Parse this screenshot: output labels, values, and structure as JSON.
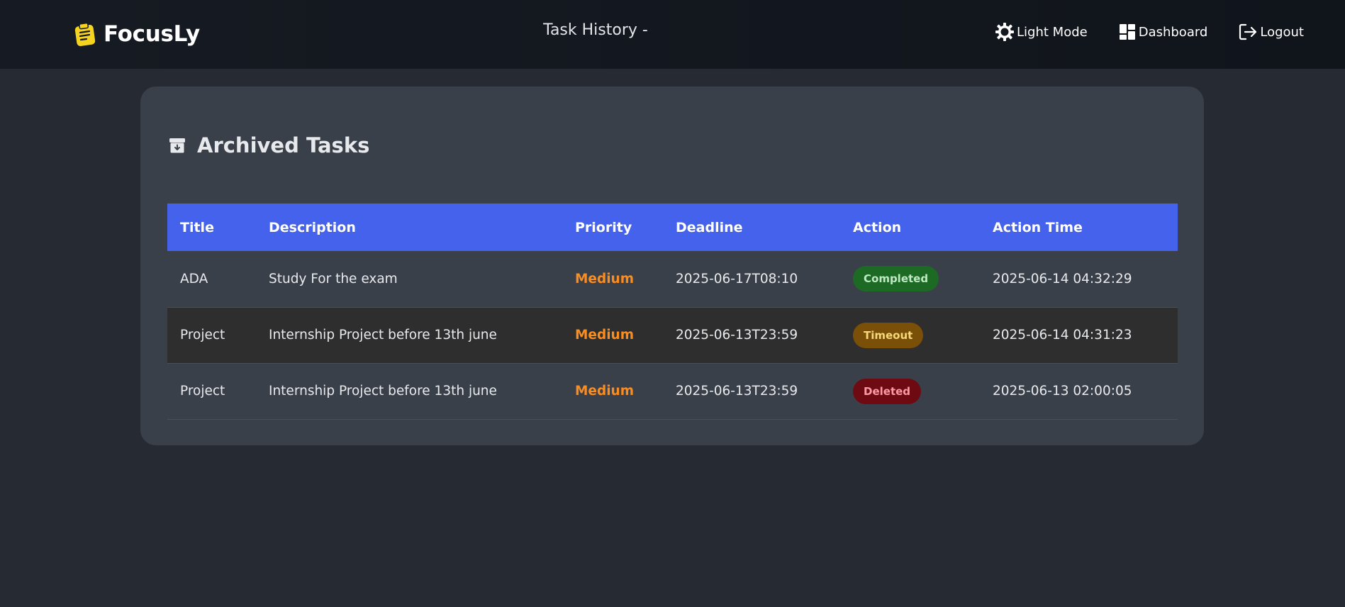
{
  "navbar": {
    "brand": "FocusLy",
    "center_title": "Task History -",
    "links": [
      {
        "label": "Light Mode",
        "icon": "sun-icon"
      },
      {
        "label": "Dashboard",
        "icon": "dashboard-icon"
      },
      {
        "label": "Logout",
        "icon": "logout-icon"
      }
    ]
  },
  "archive": {
    "title": "Archived Tasks",
    "icon": "archive-icon",
    "columns": [
      "Title",
      "Description",
      "Priority",
      "Deadline",
      "Action",
      "Action Time"
    ],
    "rows": [
      {
        "title": "ADA",
        "description": "Study For the exam",
        "priority": "Medium",
        "deadline": "2025-06-17T08:10",
        "action": "Completed",
        "action_time": "2025-06-14 04:32:29"
      },
      {
        "title": "Project",
        "description": "Internship Project before 13th june",
        "priority": "Medium",
        "deadline": "2025-06-13T23:59",
        "action": "Timeout",
        "action_time": "2025-06-14 04:31:23"
      },
      {
        "title": "Project",
        "description": "Internship Project before 13th june",
        "priority": "Medium",
        "deadline": "2025-06-13T23:59",
        "action": "Deleted",
        "action_time": "2025-06-13 02:00:05"
      }
    ]
  },
  "colors": {
    "accent": "#4562ec",
    "priority_medium": "#fb8c1e",
    "completed": "#1c6a24",
    "timeout": "#7a4f08",
    "deleted": "#6e0a12",
    "brand_icon": "#f5d31f"
  }
}
